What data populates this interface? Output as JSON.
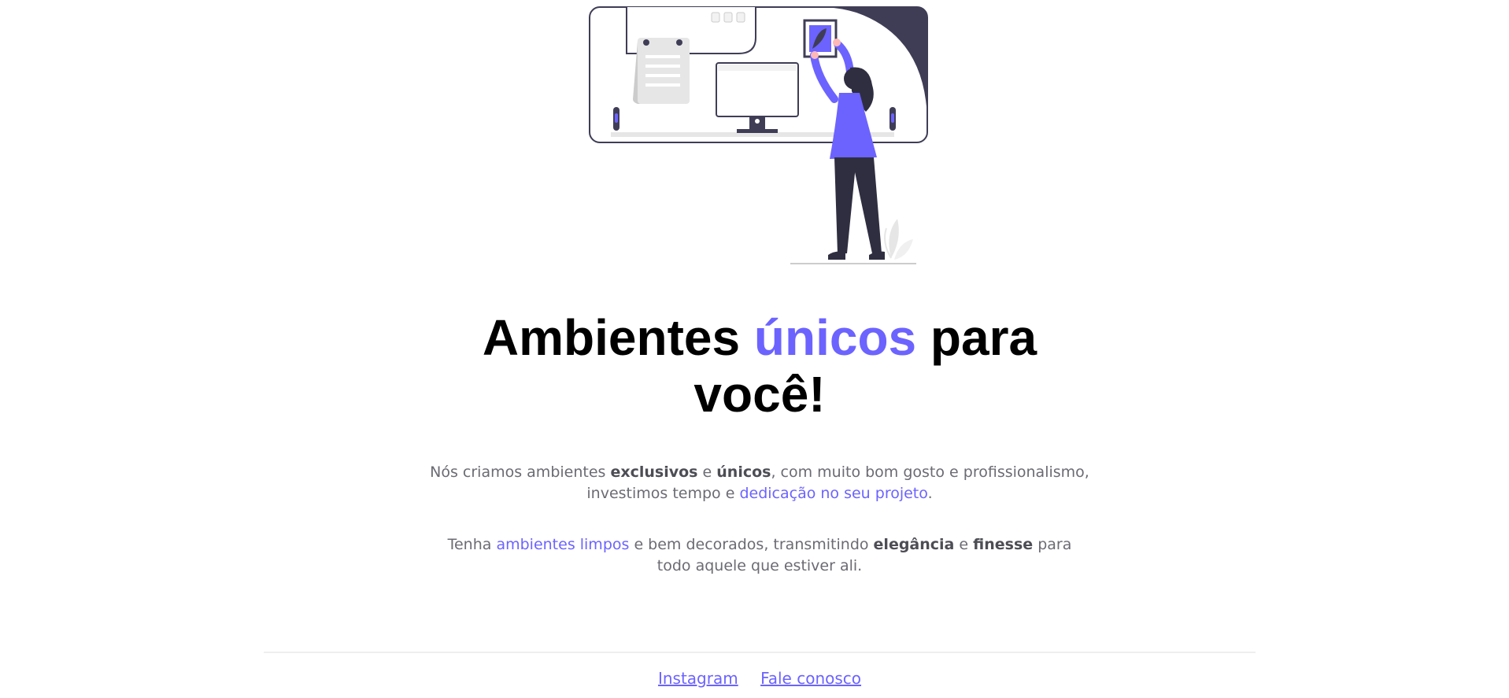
{
  "hero": {
    "illustration": "woman-hanging-frame-illustration"
  },
  "headline": {
    "part1": "Ambientes ",
    "accent": "únicos",
    "part2": " para",
    "part3": "você!"
  },
  "paragraph1": {
    "t1": "Nós criamos ambientes ",
    "b1": "exclusivos",
    "t2": " e ",
    "b2": "únicos",
    "t3": ", com muito bom gosto e profissionalismo,",
    "t4": "investimos tempo e ",
    "hl1": "dedicação no seu projeto",
    "t5": "."
  },
  "paragraph2": {
    "t1": "Tenha ",
    "hl1": "ambientes limpos",
    "t2": " e bem decorados, transmitindo ",
    "b1": "elegância",
    "t3": " e ",
    "b2": "finesse",
    "t4": " para",
    "t5": "todo aquele que estiver ali."
  },
  "footer": {
    "links": [
      "Instagram",
      "Fale conosco"
    ]
  },
  "colors": {
    "accent": "#6c63ff",
    "dark": "#3f3d56",
    "text": "#6b6b73"
  }
}
